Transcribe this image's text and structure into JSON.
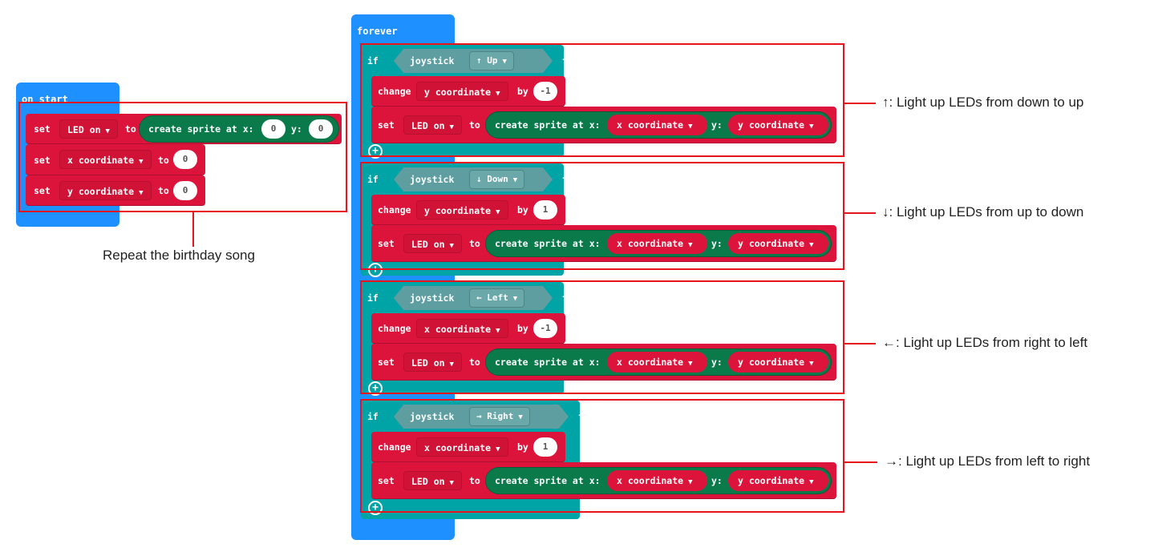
{
  "on_start": {
    "label": "on start",
    "rows": [
      {
        "kw": "set",
        "var": "LED on",
        "to": "to",
        "sprite_label": "create sprite at x:",
        "x": "0",
        "y_label": "y:",
        "y": "0"
      },
      {
        "kw": "set",
        "var": "x coordinate",
        "to": "to",
        "value": "0"
      },
      {
        "kw": "set",
        "var": "y coordinate",
        "to": "to",
        "value": "0"
      }
    ],
    "annotation": "Repeat the birthday song"
  },
  "forever": {
    "label": "forever",
    "branches": [
      {
        "if": "if",
        "sensor": "joystick",
        "direction": "↑ Up",
        "then": "then",
        "change_kw": "change",
        "change_var": "y coordinate",
        "by": "by",
        "delta": "-1",
        "set_kw": "set",
        "set_var": "LED on",
        "to": "to",
        "sprite_label": "create sprite at x:",
        "x_var": "x coordinate",
        "y_label": "y:",
        "y_var": "y coordinate",
        "annotation": "↑: Light up LEDs from down to up"
      },
      {
        "if": "if",
        "sensor": "joystick",
        "direction": "↓ Down",
        "then": "then",
        "change_kw": "change",
        "change_var": "y coordinate",
        "by": "by",
        "delta": "1",
        "set_kw": "set",
        "set_var": "LED on",
        "to": "to",
        "sprite_label": "create sprite at x:",
        "x_var": "x coordinate",
        "y_label": "y:",
        "y_var": "y coordinate",
        "annotation": "↓: Light up LEDs from up to down"
      },
      {
        "if": "if",
        "sensor": "joystick",
        "direction": "← Left",
        "then": "then",
        "change_kw": "change",
        "change_var": "x coordinate",
        "by": "by",
        "delta": "-1",
        "set_kw": "set",
        "set_var": "LED on",
        "to": "to",
        "sprite_label": "create sprite at x:",
        "x_var": "x coordinate",
        "y_label": "y:",
        "y_var": "y coordinate",
        "annotation": "←: Light up LEDs from right to left"
      },
      {
        "if": "if",
        "sensor": "joystick",
        "direction": "→ Right",
        "then": "then",
        "change_kw": "change",
        "change_var": "x coordinate",
        "by": "by",
        "delta": "1",
        "set_kw": "set",
        "set_var": "LED on",
        "to": "to",
        "sprite_label": "create sprite at x:",
        "x_var": "x coordinate",
        "y_label": "y:",
        "y_var": "y coordinate",
        "annotation": "→: Light up LEDs from left to right"
      }
    ]
  },
  "colors": {
    "event": "#1e90ff",
    "variables": "#dc143c",
    "sprite": "#0b7a4b",
    "logic": "#00a4a6",
    "sensor": "#5f9ea0",
    "highlight": "#e8141b"
  }
}
